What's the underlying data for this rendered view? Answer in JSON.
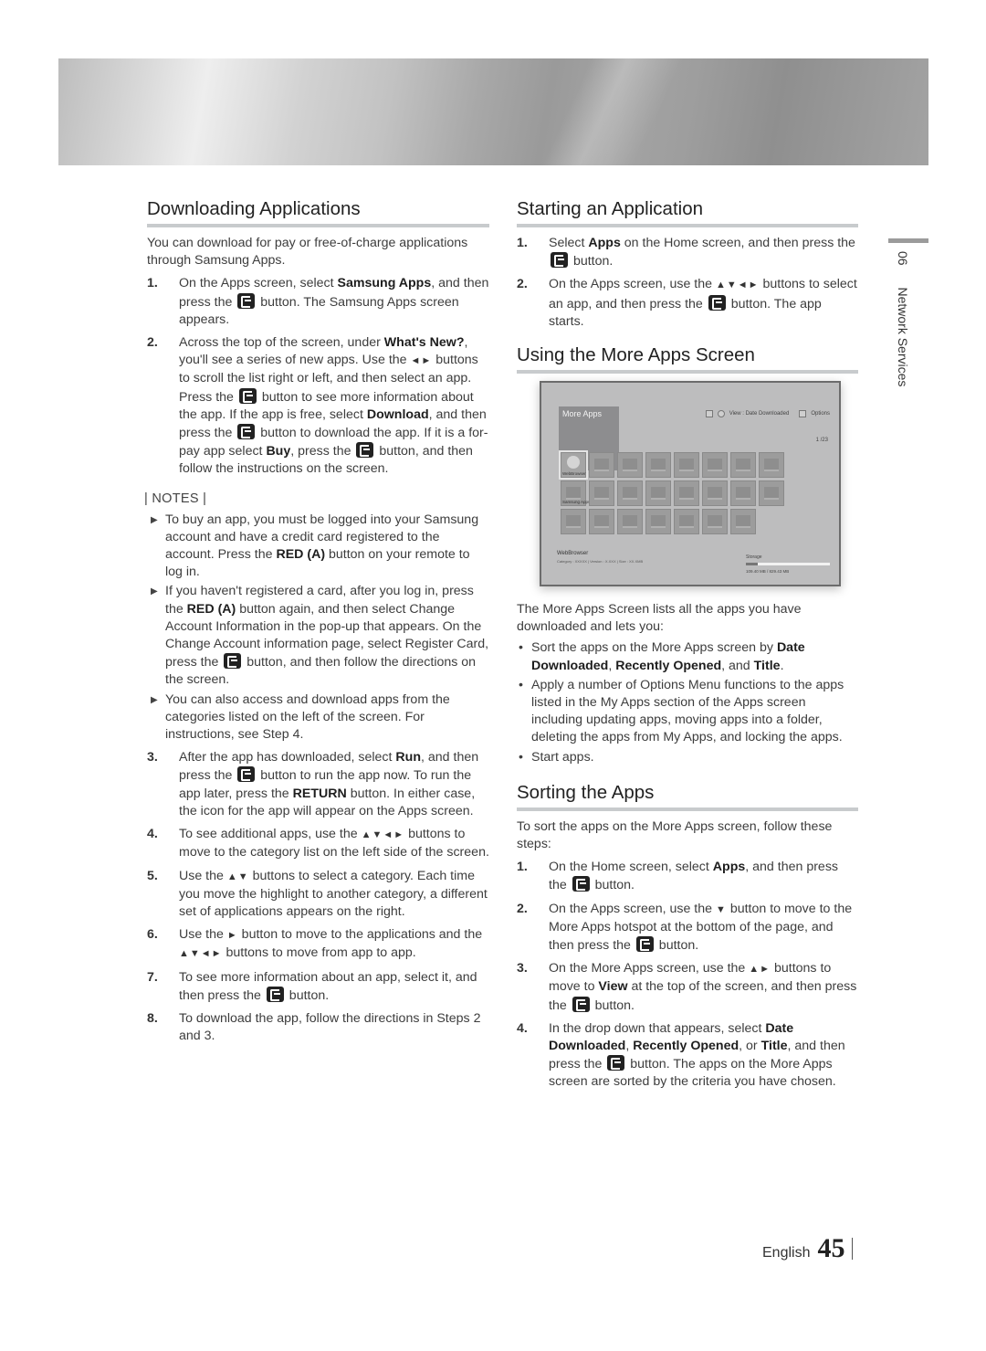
{
  "sidebar": {
    "chapter": "06",
    "section": "Network Services"
  },
  "footer": {
    "language": "English",
    "page": "45"
  },
  "downloading": {
    "title": "Downloading Applications",
    "intro": "You can download for pay or free-of-charge applications through Samsung Apps.",
    "steps": [
      {
        "num": "1.",
        "parts": [
          "On the Apps screen, select ",
          "Samsung Apps",
          ", and then press the ",
          " button. The Samsung Apps screen appears."
        ]
      },
      {
        "num": "2.",
        "parts": [
          "Across the top of the screen, under ",
          "What's New?",
          ", you'll see a series of new apps. Use the ",
          " buttons to scroll the list right or left, and then select an app. Press the ",
          " button to see more information about the app. If the app is free, select ",
          "Download",
          ", and then press the ",
          " button to download the app. If it is a for-pay app select ",
          "Buy",
          ", press the ",
          " button, and then follow the instructions on the screen."
        ]
      },
      {
        "num": "3.",
        "parts": [
          "After the app has downloaded, select ",
          "Run",
          ", and then press the ",
          " button to run the app now. To run the app later, press the ",
          "RETURN",
          " button. In either case, the icon for the app will appear on the Apps screen."
        ]
      },
      {
        "num": "4.",
        "parts": [
          "To see additional apps, use the ",
          " buttons to move to the category list on the left side of the screen."
        ]
      },
      {
        "num": "5.",
        "parts": [
          "Use the ",
          " buttons to select a category. Each time you move the highlight to another category, a different set of applications appears on the right."
        ]
      },
      {
        "num": "6.",
        "parts": [
          "Use the ",
          " button to move to the applications and the ",
          " buttons to move from app to app."
        ]
      },
      {
        "num": "7.",
        "parts": [
          "To see more information about an app, select it, and then press the ",
          " button."
        ]
      },
      {
        "num": "8.",
        "parts": [
          "To download the app, follow the directions in Steps 2 and 3."
        ]
      }
    ],
    "notes_title": "| NOTES |",
    "notes": [
      {
        "parts": [
          "To buy an app, you must be logged into your Samsung account and have a credit card registered to the account. Press the ",
          "RED (A)",
          " button on your remote to log in."
        ]
      },
      {
        "parts": [
          "If you haven't registered a card, after you log in, press the ",
          "RED (A)",
          " button again, and then select Change Account Information in the pop-up that appears. On the Change Account information page, select Register Card, press the ",
          " button, and then follow the directions on the screen."
        ]
      },
      {
        "parts": [
          "You can also access and download apps from the categories listed on the left of the screen. For instructions, see Step 4."
        ]
      }
    ]
  },
  "starting": {
    "title": "Starting an Application",
    "steps": [
      {
        "num": "1.",
        "parts": [
          "Select ",
          "Apps",
          " on the Home screen, and then press the ",
          " button."
        ]
      },
      {
        "num": "2.",
        "parts": [
          "On the Apps screen, use the ",
          " buttons to select an app, and then press the ",
          " button. The app starts."
        ]
      }
    ]
  },
  "more_apps": {
    "title": "Using the More Apps Screen",
    "screen": {
      "title": "More Apps",
      "view_label": "View : Date Downloaded",
      "options_label": "Options",
      "pager": "1 /23",
      "tile_rows": [
        8,
        8,
        7
      ],
      "selected_tile_label": "WebBrowser",
      "second_row_label": "Samsung Apps",
      "info_name": "WebBrowser",
      "info_meta": "Category : XXXXX  |  Version : X.XXX  |  Size : XX.XMB",
      "storage_label": "Storage",
      "storage_used_fraction": 0.14,
      "storage_value": "109.40 MB / 829.43 MB"
    },
    "intro": "The More Apps Screen lists all the apps you have downloaded and lets you:",
    "bullets": [
      {
        "parts": [
          "Sort the apps on the More Apps screen by ",
          "Date Downloaded",
          ", ",
          "Recently Opened",
          ", and ",
          "Title",
          "."
        ]
      },
      {
        "parts": [
          "Apply a number of Options Menu functions to the apps listed in the My Apps section of the Apps screen including updating apps, moving apps into a folder, deleting the apps from My Apps, and locking the apps."
        ]
      },
      {
        "parts": [
          "Start apps."
        ]
      }
    ]
  },
  "sorting": {
    "title": "Sorting the Apps",
    "intro": "To sort the apps on the More Apps screen, follow these steps:",
    "steps": [
      {
        "num": "1.",
        "parts": [
          "On the Home screen, select ",
          "Apps",
          ", and then press the ",
          " button."
        ]
      },
      {
        "num": "2.",
        "parts": [
          "On the Apps screen, use the ",
          " button to move to the More Apps hotspot at the bottom of the page, and then press the ",
          " button."
        ]
      },
      {
        "num": "3.",
        "parts": [
          "On the More Apps screen, use the ",
          " buttons to move to ",
          "View",
          " at the top of the screen, and then press the ",
          " button."
        ]
      },
      {
        "num": "4.",
        "parts": [
          "In the drop down that appears, select ",
          "Date Downloaded",
          ", ",
          "Recently Opened",
          ", or ",
          "Title",
          ", and then press the ",
          " button. The apps on the More Apps screen are sorted by the criteria you have chosen."
        ]
      }
    ]
  },
  "glyphs": {
    "lr": "◄►",
    "udlr": "▲▼◄►",
    "ud": "▲▼",
    "r": "►",
    "d": "▼",
    "ur": "▲►",
    "note_bullet": "▶",
    "dot": "•"
  }
}
